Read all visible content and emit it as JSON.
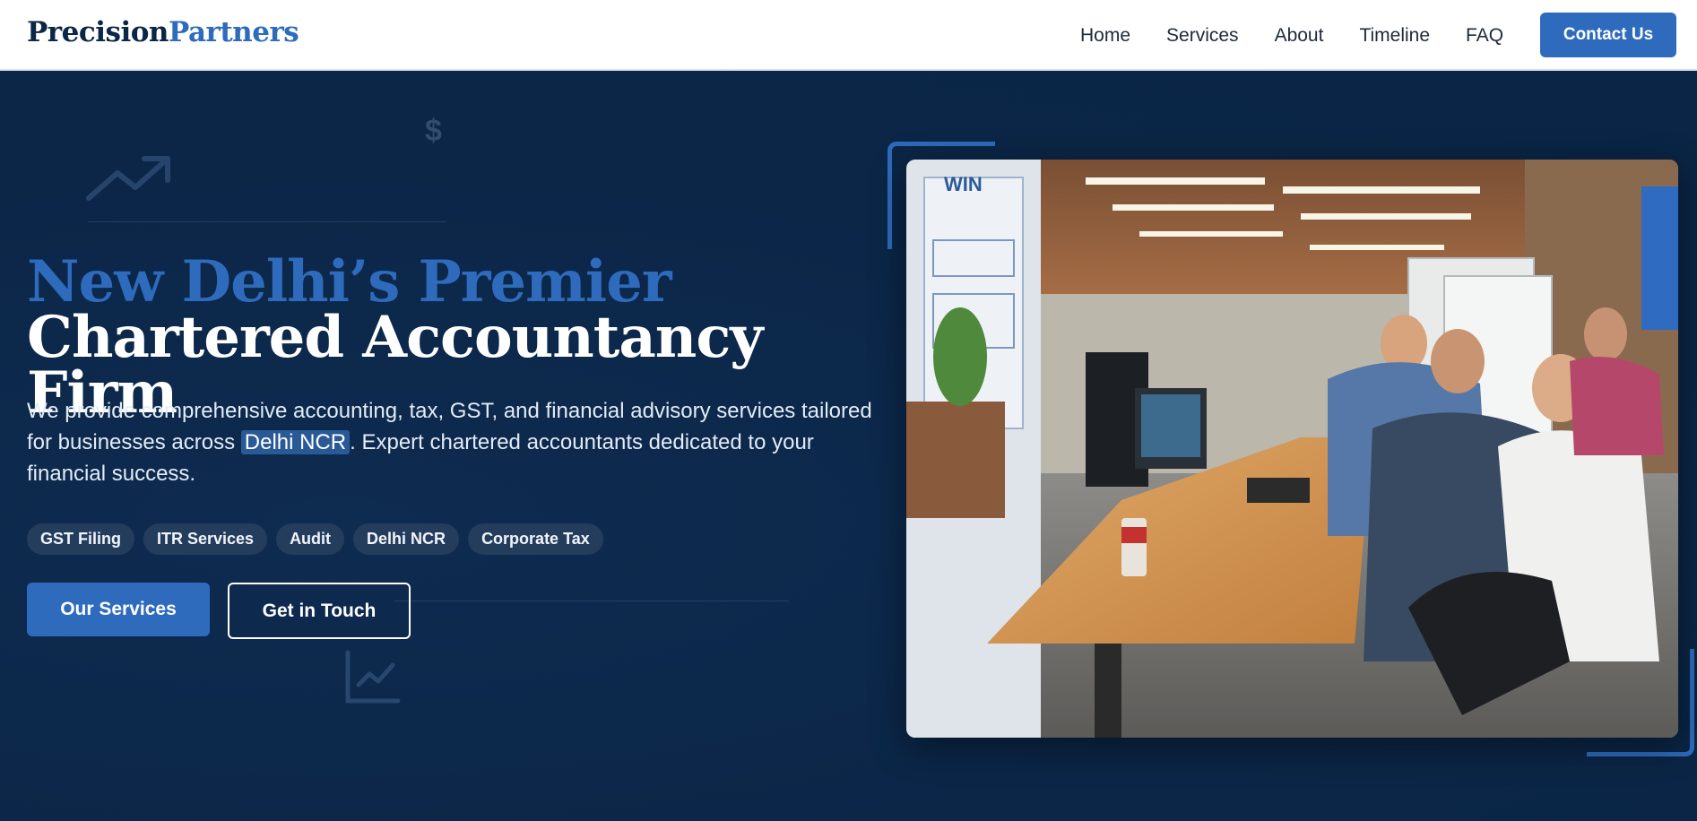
{
  "brand": {
    "part1": "Precision",
    "part2": "Partners"
  },
  "nav": {
    "items": [
      {
        "label": "Home"
      },
      {
        "label": "Services"
      },
      {
        "label": "About"
      },
      {
        "label": "Timeline"
      },
      {
        "label": "FAQ"
      }
    ],
    "cta_label": "Contact Us"
  },
  "hero": {
    "headline_accent": "New Delhi’s Premier",
    "headline_rest": " Chartered Accountancy Firm",
    "intro_before": "We provide comprehensive accounting, tax, GST, and financial advisory services tailored for businesses across ",
    "intro_highlight": "Delhi NCR",
    "intro_after": ". Expert chartered accountants dedicated to your financial success.",
    "tags": [
      "GST Filing",
      "ITR Services",
      "Audit",
      "Delhi NCR",
      "Corporate Tax"
    ],
    "primary_button": "Our Services",
    "secondary_button": "Get in Touch",
    "photo": {
      "sign_text": "WIN"
    }
  },
  "decorations": {
    "dollar_glyph": "$",
    "icons": [
      "trending-up-icon",
      "line-chart-icon"
    ]
  },
  "colors": {
    "navy": "#0b2647",
    "accent": "#2e6bbd",
    "white": "#ffffff"
  }
}
